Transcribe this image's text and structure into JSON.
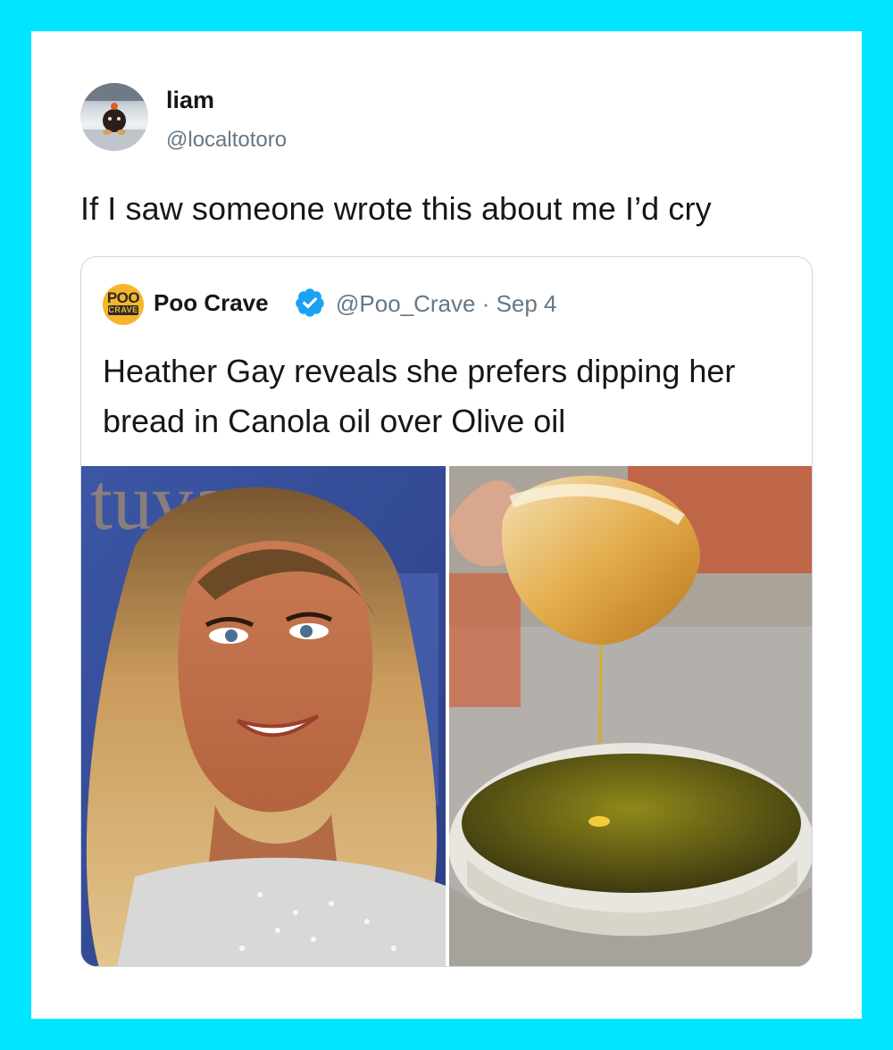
{
  "tweet": {
    "author_name": "liam",
    "author_handle": "@localtotoro",
    "text": "If I saw someone wrote this about me I’d cry"
  },
  "quoted_tweet": {
    "logo_line1": "POO",
    "logo_line2": "CRAVE",
    "author_name": "Poo Crave",
    "verified": true,
    "handle_date": "@Poo_Crave · Sep 4",
    "text": "Heather Gay reveals she prefers dipping her bread in Canola oil over Olive oil",
    "backdrop_text": "tuvas",
    "images": [
      {
        "icon": "photo-woman-smiling"
      },
      {
        "icon": "photo-bread-dipping-oil"
      }
    ]
  },
  "colors": {
    "frame": "#00e5ff",
    "verified": "#1da1f2",
    "secondary_text": "#657786"
  }
}
